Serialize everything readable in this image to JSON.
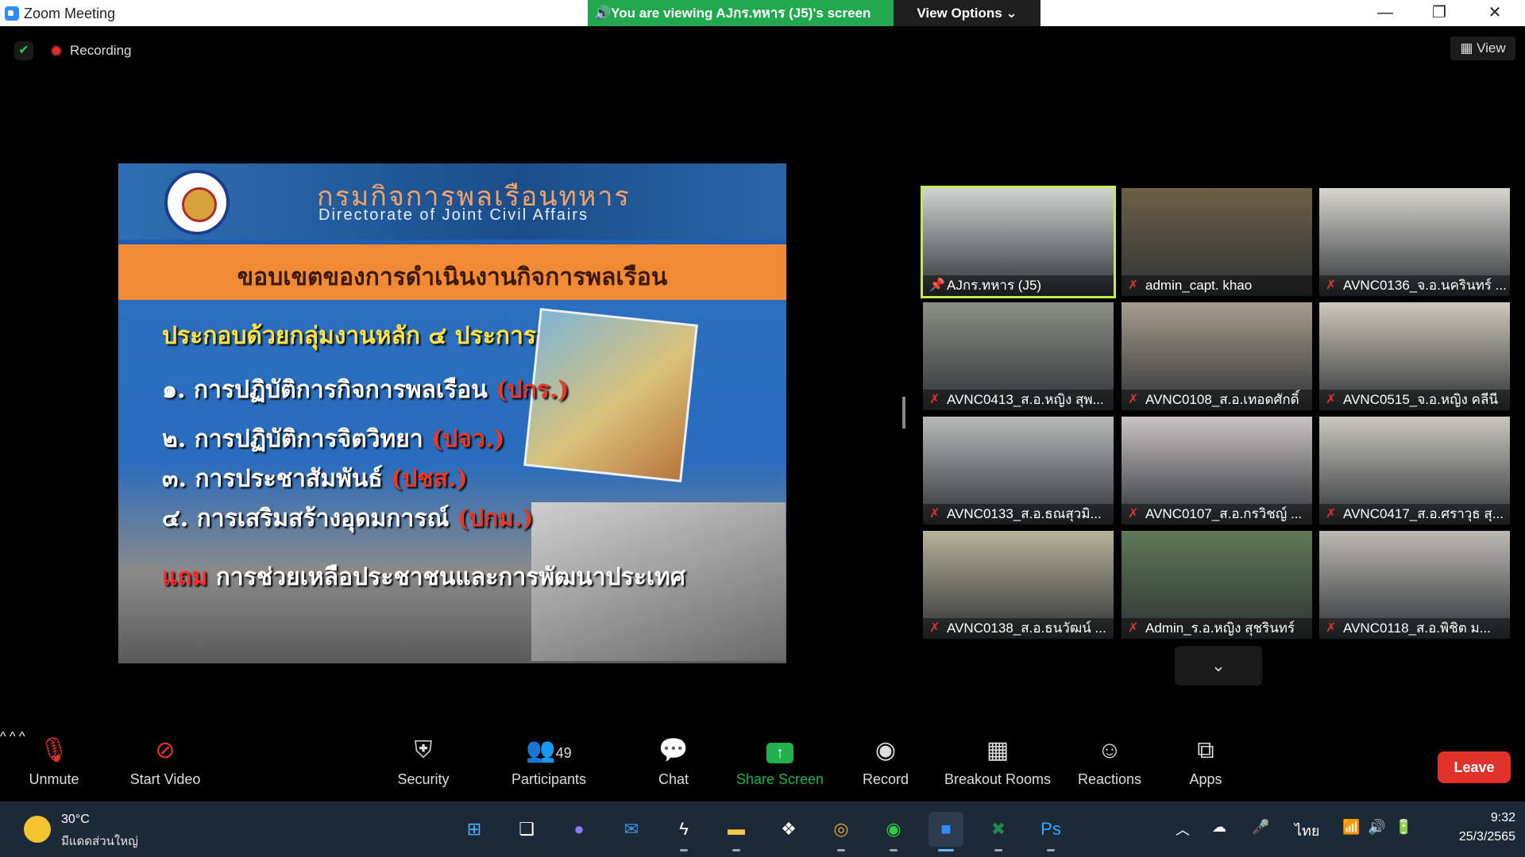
{
  "window": {
    "title": "Zoom Meeting",
    "viewing_banner": "You are viewing AJกร.ทหาร (J5)'s screen",
    "view_options": "View Options",
    "view_button": "View"
  },
  "status": {
    "recording": "Recording"
  },
  "slide": {
    "title_th": "กรมกิจการพลเรือนทหาร",
    "title_en": "Directorate of Joint Civil Affairs",
    "band": "ขอบเขตของการดำเนินงานกิจการพลเรือน",
    "subtitle": "ประกอบด้วยกลุ่มงานหลัก ๔ ประการ",
    "items": [
      {
        "text": "๑. การปฏิบัติการกิจการพลเรือน",
        "abbr": "(ปกร.)"
      },
      {
        "text": "๒. การปฏิบัติการจิตวิทยา",
        "abbr": "(ปจว.)"
      },
      {
        "text": "๓. การประชาสัมพันธ์",
        "abbr": "(ปชส.)"
      },
      {
        "text": "๔. การเสริมสร้างอุดมการณ์",
        "abbr": "(ปกม.)"
      }
    ],
    "extra_prefix": "แถม",
    "extra_text": "การช่วยเหลือประชาชนและการพัฒนาประเทศ"
  },
  "gallery": [
    {
      "name": "AJกร.ทหาร (J5)",
      "active": true,
      "muted": false
    },
    {
      "name": "admin_capt. khao",
      "active": false,
      "muted": true
    },
    {
      "name": "AVNC0136_จ.อ.นครินทร์ ...",
      "active": false,
      "muted": true
    },
    {
      "name": "AVNC0413_ส.อ.หญิง สุพ...",
      "active": false,
      "muted": true
    },
    {
      "name": "AVNC0108_ส.อ.เทอดศักดิ์",
      "active": false,
      "muted": true
    },
    {
      "name": "AVNC0515_จ.อ.หญิง คลีนี",
      "active": false,
      "muted": true
    },
    {
      "name": "AVNC0133_ส.อ.ธณสุวมิ...",
      "active": false,
      "muted": true
    },
    {
      "name": "AVNC0107_ส.อ.กรวิชญ์ ...",
      "active": false,
      "muted": true
    },
    {
      "name": "AVNC0417_ส.อ.ศราวุธ สุ...",
      "active": false,
      "muted": true
    },
    {
      "name": "AVNC0138_ส.อ.ธนวัฒน์ ...",
      "active": false,
      "muted": true
    },
    {
      "name": "Admin_ร.อ.หญิง สุชรินทร์",
      "active": false,
      "muted": true
    },
    {
      "name": "AVNC0118_ส.อ.พิชิต ม...",
      "active": false,
      "muted": true
    }
  ],
  "toolbar": {
    "unmute": "Unmute",
    "start_video": "Start Video",
    "security": "Security",
    "participants": "Participants",
    "participants_count": "49",
    "chat": "Chat",
    "share_screen": "Share Screen",
    "record": "Record",
    "breakout_rooms": "Breakout Rooms",
    "reactions": "Reactions",
    "apps": "Apps",
    "leave": "Leave"
  },
  "taskbar": {
    "weather_temp": "30°C",
    "weather_desc": "มีแดดส่วนใหญ่",
    "language": "ไทย",
    "time": "9:32",
    "date": "25/3/2565"
  },
  "colors": {
    "banner_green": "#22a94f",
    "active_outline": "#c7e94b",
    "leave_red": "#e0322b",
    "muted_red": "#e0332b"
  }
}
